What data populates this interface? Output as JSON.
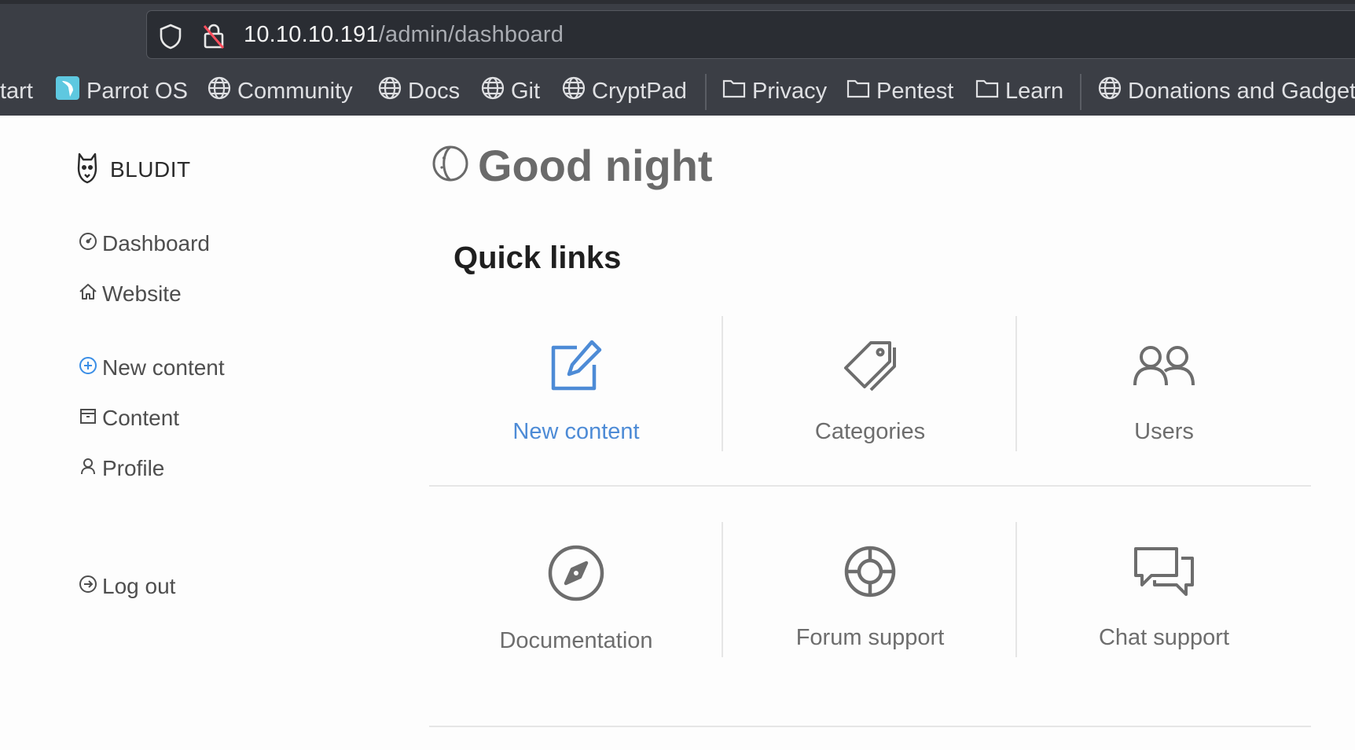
{
  "browser": {
    "url_host": "10.10.10.191",
    "url_path": "/admin/dashboard",
    "bookmarks": [
      {
        "label": "tart",
        "icon": "none"
      },
      {
        "label": "Parrot OS",
        "icon": "parrot-icon"
      },
      {
        "label": "Community",
        "icon": "globe-icon"
      },
      {
        "label": "Docs",
        "icon": "globe-icon"
      },
      {
        "label": "Git",
        "icon": "globe-icon"
      },
      {
        "label": "CryptPad",
        "icon": "globe-icon"
      },
      {
        "label": "Privacy",
        "icon": "folder-icon"
      },
      {
        "label": "Pentest",
        "icon": "folder-icon"
      },
      {
        "label": "Learn",
        "icon": "folder-icon"
      },
      {
        "label": "Donations and Gadget",
        "icon": "globe-icon"
      }
    ]
  },
  "sidebar": {
    "brand": "BLUDIT",
    "items": [
      {
        "label": "Dashboard",
        "icon": "dashboard-gauge-icon"
      },
      {
        "label": "Website",
        "icon": "home-icon"
      },
      {
        "label": "New content",
        "icon": "plus-circle-icon"
      },
      {
        "label": "Content",
        "icon": "archive-icon"
      },
      {
        "label": "Profile",
        "icon": "person-icon"
      },
      {
        "label": "Log out",
        "icon": "logout-arrow-icon"
      }
    ]
  },
  "main": {
    "greeting": "Good night",
    "greeting_icon": "moon-icon",
    "quick_links_title": "Quick links",
    "quick_links": [
      {
        "label": "New content",
        "icon": "edit-icon"
      },
      {
        "label": "Categories",
        "icon": "tag-icon"
      },
      {
        "label": "Users",
        "icon": "users-icon"
      },
      {
        "label": "Documentation",
        "icon": "compass-icon"
      },
      {
        "label": "Forum support",
        "icon": "lifebuoy-icon"
      },
      {
        "label": "Chat support",
        "icon": "chat-icon"
      }
    ]
  },
  "colors": {
    "accent": "#4d8bd6",
    "text_muted": "#6d6d6d",
    "chrome_bg": "#3b3e45"
  }
}
